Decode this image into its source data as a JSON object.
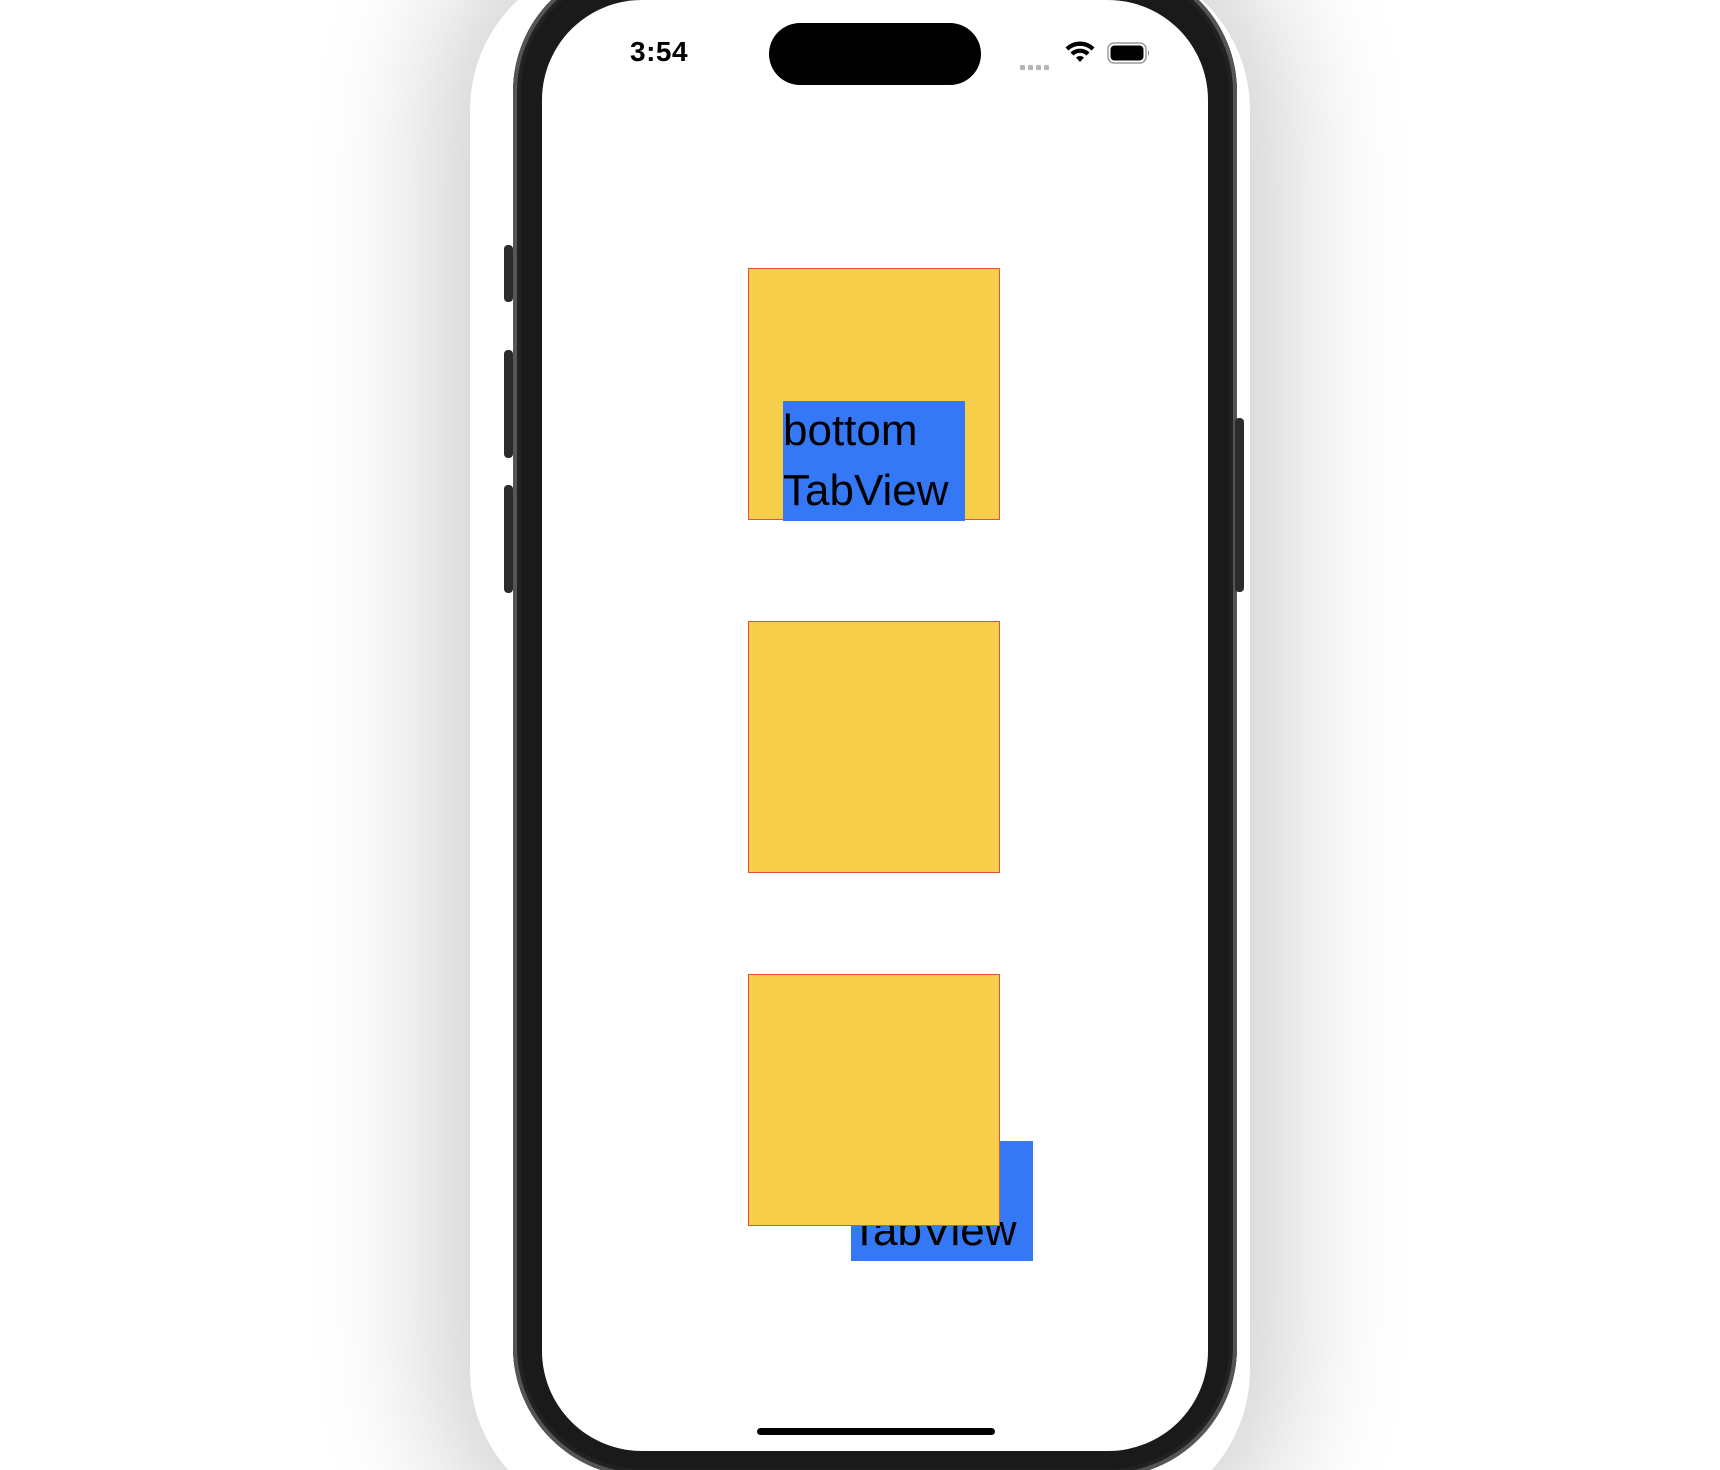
{
  "status_bar": {
    "time": "3:54",
    "signal_icon": "cellular-signal-icon",
    "wifi_icon": "wifi-icon",
    "battery_icon": "battery-icon"
  },
  "boxes": [
    {
      "label": "bottom\nTabView"
    },
    {
      "label": ""
    },
    {
      "label": "bottom\nTabView"
    }
  ],
  "colors": {
    "box_fill": "#f7ce49",
    "box_border": "#e8503a",
    "label_bg": "#3478f6"
  }
}
